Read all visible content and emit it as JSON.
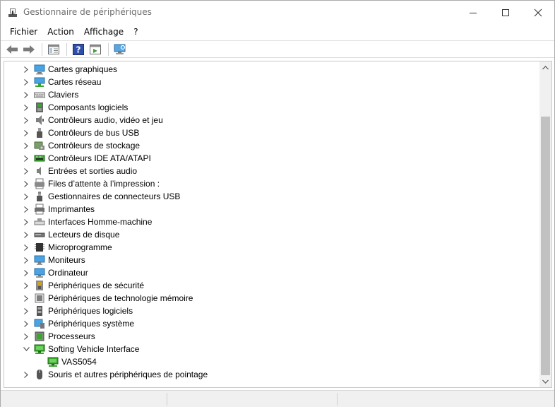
{
  "window": {
    "title": "Gestionnaire de périphériques"
  },
  "menu": {
    "items": [
      "Fichier",
      "Action",
      "Affichage",
      "?"
    ]
  },
  "toolbar": {
    "buttons": [
      "back-icon",
      "forward-icon",
      "properties-pane-icon",
      "help-icon",
      "run-icon",
      "monitor-scan-icon"
    ]
  },
  "tree": {
    "items": [
      {
        "label": "Cartes graphiques",
        "icon": "display-adapter-icon",
        "expanded": false
      },
      {
        "label": "Cartes réseau",
        "icon": "network-adapter-icon",
        "expanded": false
      },
      {
        "label": "Claviers",
        "icon": "keyboard-icon",
        "expanded": false
      },
      {
        "label": "Composants logiciels",
        "icon": "software-component-icon",
        "expanded": false
      },
      {
        "label": "Contrôleurs audio, vidéo et jeu",
        "icon": "speaker-icon",
        "expanded": false
      },
      {
        "label": "Contrôleurs de bus USB",
        "icon": "usb-icon",
        "expanded": false
      },
      {
        "label": "Contrôleurs de stockage",
        "icon": "storage-controller-icon",
        "expanded": false
      },
      {
        "label": "Contrôleurs IDE ATA/ATAPI",
        "icon": "ide-controller-icon",
        "expanded": false
      },
      {
        "label": "Entrées et sorties audio",
        "icon": "audio-io-icon",
        "expanded": false
      },
      {
        "label": "Files d’attente à l’impression :",
        "icon": "print-queue-icon",
        "expanded": false
      },
      {
        "label": "Gestionnaires de connecteurs USB",
        "icon": "usb-connector-icon",
        "expanded": false
      },
      {
        "label": "Imprimantes",
        "icon": "printer-icon",
        "expanded": false
      },
      {
        "label": "Interfaces Homme-machine",
        "icon": "hid-icon",
        "expanded": false
      },
      {
        "label": "Lecteurs de disque",
        "icon": "disk-drive-icon",
        "expanded": false
      },
      {
        "label": "Microprogramme",
        "icon": "firmware-icon",
        "expanded": false
      },
      {
        "label": "Moniteurs",
        "icon": "monitor-icon",
        "expanded": false
      },
      {
        "label": "Ordinateur",
        "icon": "computer-icon",
        "expanded": false
      },
      {
        "label": "Périphériques de sécurité",
        "icon": "security-device-icon",
        "expanded": false
      },
      {
        "label": "Périphériques de technologie mémoire",
        "icon": "memory-device-icon",
        "expanded": false
      },
      {
        "label": "Périphériques logiciels",
        "icon": "software-device-icon",
        "expanded": false
      },
      {
        "label": "Périphériques système",
        "icon": "system-device-icon",
        "expanded": false
      },
      {
        "label": "Processeurs",
        "icon": "processor-icon",
        "expanded": false
      },
      {
        "label": "Softing Vehicle Interface",
        "icon": "vehicle-interface-icon",
        "expanded": true
      },
      {
        "label": "VAS5054",
        "icon": "vehicle-interface-icon",
        "child": true
      },
      {
        "label": "Souris et autres périphériques de pointage",
        "icon": "mouse-icon",
        "expanded": false
      }
    ]
  },
  "colors": {
    "highlight": "#f7f500",
    "accent_green": "#3aa62f",
    "accent_blue": "#1e73be"
  }
}
